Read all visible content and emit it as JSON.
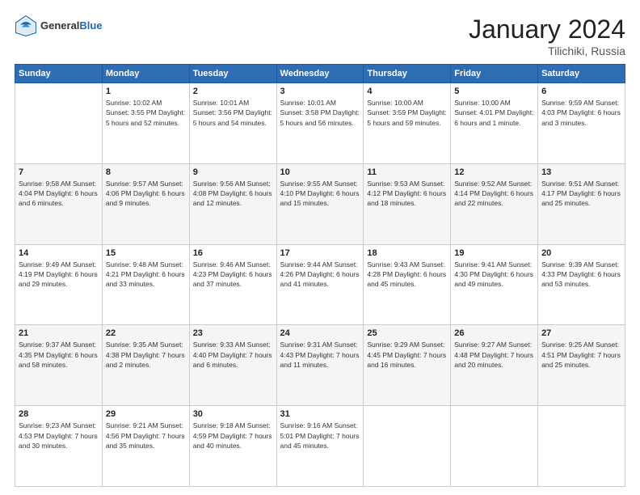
{
  "header": {
    "logo_general": "General",
    "logo_blue": "Blue",
    "title": "January 2024",
    "location": "Tilichiki, Russia"
  },
  "weekdays": [
    "Sunday",
    "Monday",
    "Tuesday",
    "Wednesday",
    "Thursday",
    "Friday",
    "Saturday"
  ],
  "weeks": [
    [
      {
        "day": "",
        "info": ""
      },
      {
        "day": "1",
        "info": "Sunrise: 10:02 AM\nSunset: 3:55 PM\nDaylight: 5 hours\nand 52 minutes."
      },
      {
        "day": "2",
        "info": "Sunrise: 10:01 AM\nSunset: 3:56 PM\nDaylight: 5 hours\nand 54 minutes."
      },
      {
        "day": "3",
        "info": "Sunrise: 10:01 AM\nSunset: 3:58 PM\nDaylight: 5 hours\nand 56 minutes."
      },
      {
        "day": "4",
        "info": "Sunrise: 10:00 AM\nSunset: 3:59 PM\nDaylight: 5 hours\nand 59 minutes."
      },
      {
        "day": "5",
        "info": "Sunrise: 10:00 AM\nSunset: 4:01 PM\nDaylight: 6 hours\nand 1 minute."
      },
      {
        "day": "6",
        "info": "Sunrise: 9:59 AM\nSunset: 4:03 PM\nDaylight: 6 hours\nand 3 minutes."
      }
    ],
    [
      {
        "day": "7",
        "info": "Sunrise: 9:58 AM\nSunset: 4:04 PM\nDaylight: 6 hours\nand 6 minutes."
      },
      {
        "day": "8",
        "info": "Sunrise: 9:57 AM\nSunset: 4:06 PM\nDaylight: 6 hours\nand 9 minutes."
      },
      {
        "day": "9",
        "info": "Sunrise: 9:56 AM\nSunset: 4:08 PM\nDaylight: 6 hours\nand 12 minutes."
      },
      {
        "day": "10",
        "info": "Sunrise: 9:55 AM\nSunset: 4:10 PM\nDaylight: 6 hours\nand 15 minutes."
      },
      {
        "day": "11",
        "info": "Sunrise: 9:53 AM\nSunset: 4:12 PM\nDaylight: 6 hours\nand 18 minutes."
      },
      {
        "day": "12",
        "info": "Sunrise: 9:52 AM\nSunset: 4:14 PM\nDaylight: 6 hours\nand 22 minutes."
      },
      {
        "day": "13",
        "info": "Sunrise: 9:51 AM\nSunset: 4:17 PM\nDaylight: 6 hours\nand 25 minutes."
      }
    ],
    [
      {
        "day": "14",
        "info": "Sunrise: 9:49 AM\nSunset: 4:19 PM\nDaylight: 6 hours\nand 29 minutes."
      },
      {
        "day": "15",
        "info": "Sunrise: 9:48 AM\nSunset: 4:21 PM\nDaylight: 6 hours\nand 33 minutes."
      },
      {
        "day": "16",
        "info": "Sunrise: 9:46 AM\nSunset: 4:23 PM\nDaylight: 6 hours\nand 37 minutes."
      },
      {
        "day": "17",
        "info": "Sunrise: 9:44 AM\nSunset: 4:26 PM\nDaylight: 6 hours\nand 41 minutes."
      },
      {
        "day": "18",
        "info": "Sunrise: 9:43 AM\nSunset: 4:28 PM\nDaylight: 6 hours\nand 45 minutes."
      },
      {
        "day": "19",
        "info": "Sunrise: 9:41 AM\nSunset: 4:30 PM\nDaylight: 6 hours\nand 49 minutes."
      },
      {
        "day": "20",
        "info": "Sunrise: 9:39 AM\nSunset: 4:33 PM\nDaylight: 6 hours\nand 53 minutes."
      }
    ],
    [
      {
        "day": "21",
        "info": "Sunrise: 9:37 AM\nSunset: 4:35 PM\nDaylight: 6 hours\nand 58 minutes."
      },
      {
        "day": "22",
        "info": "Sunrise: 9:35 AM\nSunset: 4:38 PM\nDaylight: 7 hours\nand 2 minutes."
      },
      {
        "day": "23",
        "info": "Sunrise: 9:33 AM\nSunset: 4:40 PM\nDaylight: 7 hours\nand 6 minutes."
      },
      {
        "day": "24",
        "info": "Sunrise: 9:31 AM\nSunset: 4:43 PM\nDaylight: 7 hours\nand 11 minutes."
      },
      {
        "day": "25",
        "info": "Sunrise: 9:29 AM\nSunset: 4:45 PM\nDaylight: 7 hours\nand 16 minutes."
      },
      {
        "day": "26",
        "info": "Sunrise: 9:27 AM\nSunset: 4:48 PM\nDaylight: 7 hours\nand 20 minutes."
      },
      {
        "day": "27",
        "info": "Sunrise: 9:25 AM\nSunset: 4:51 PM\nDaylight: 7 hours\nand 25 minutes."
      }
    ],
    [
      {
        "day": "28",
        "info": "Sunrise: 9:23 AM\nSunset: 4:53 PM\nDaylight: 7 hours\nand 30 minutes."
      },
      {
        "day": "29",
        "info": "Sunrise: 9:21 AM\nSunset: 4:56 PM\nDaylight: 7 hours\nand 35 minutes."
      },
      {
        "day": "30",
        "info": "Sunrise: 9:18 AM\nSunset: 4:59 PM\nDaylight: 7 hours\nand 40 minutes."
      },
      {
        "day": "31",
        "info": "Sunrise: 9:16 AM\nSunset: 5:01 PM\nDaylight: 7 hours\nand 45 minutes."
      },
      {
        "day": "",
        "info": ""
      },
      {
        "day": "",
        "info": ""
      },
      {
        "day": "",
        "info": ""
      }
    ]
  ]
}
